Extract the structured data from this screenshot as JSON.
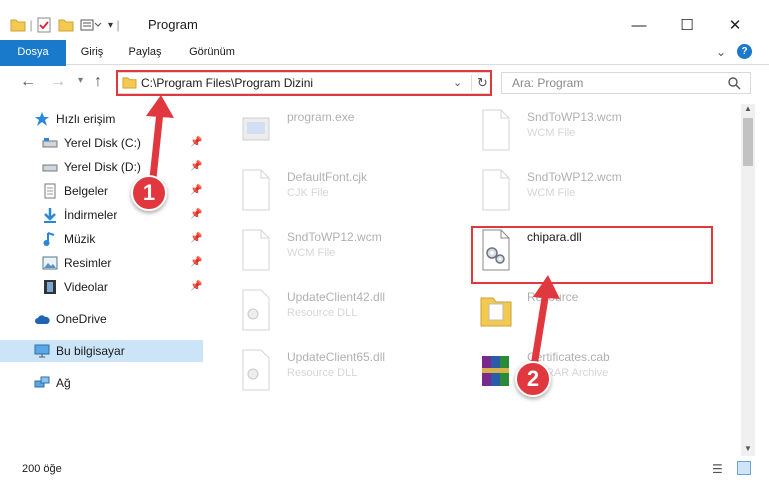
{
  "window": {
    "title": "Program",
    "controls": {
      "minimize": "—",
      "maximize": "☐",
      "close": "✕"
    }
  },
  "quick_access_toolbar": {
    "icons": [
      "folder-icon",
      "properties-check-icon",
      "new-folder-icon",
      "customize-icon"
    ]
  },
  "ribbon": {
    "tabs": [
      {
        "label": "Dosya",
        "active": true
      },
      {
        "label": "Giriş"
      },
      {
        "label": "Paylaş"
      },
      {
        "label": "Görünüm"
      }
    ]
  },
  "address": {
    "path": "C:\\Program Files\\Program Dizini",
    "search_placeholder": "Ara: Program"
  },
  "nav": {
    "quick_access_label": "Hızlı erişim",
    "items": [
      {
        "label": "Yerel Disk (C:)",
        "pinned": true
      },
      {
        "label": "Yerel Disk (D:)",
        "pinned": true
      },
      {
        "label": "Belgeler",
        "pinned": true
      },
      {
        "label": "İndirmeler",
        "pinned": true
      },
      {
        "label": "Müzik",
        "pinned": true
      },
      {
        "label": "Resimler",
        "pinned": true
      },
      {
        "label": "Videolar",
        "pinned": true
      }
    ],
    "onedrive": "OneDrive",
    "this_pc": "Bu bilgisayar",
    "network": "Ağ"
  },
  "files": [
    {
      "name": "program.exe",
      "type": ""
    },
    {
      "name": "SndToWP13.wcm",
      "type": "WCM File"
    },
    {
      "name": "DefaultFont.cjk",
      "type": "CJK File"
    },
    {
      "name": "SndToWP12.wcm",
      "type": "WCM File"
    },
    {
      "name": "SndToWP12.wcm",
      "type": "WCM File"
    },
    {
      "name": "chipara.dll",
      "type": ""
    },
    {
      "name": "UpdateClient42.dll",
      "type": "Resource DLL"
    },
    {
      "name": "Resource",
      "type": ""
    },
    {
      "name": "UpdateClient65.dll",
      "type": "Resource DLL"
    },
    {
      "name": "Certificates.cab",
      "type": "WinRAR Archive"
    }
  ],
  "status": {
    "item_count": "200 öğe"
  },
  "annotations": {
    "step1": "1",
    "step2": "2",
    "color": "#e0383e"
  }
}
